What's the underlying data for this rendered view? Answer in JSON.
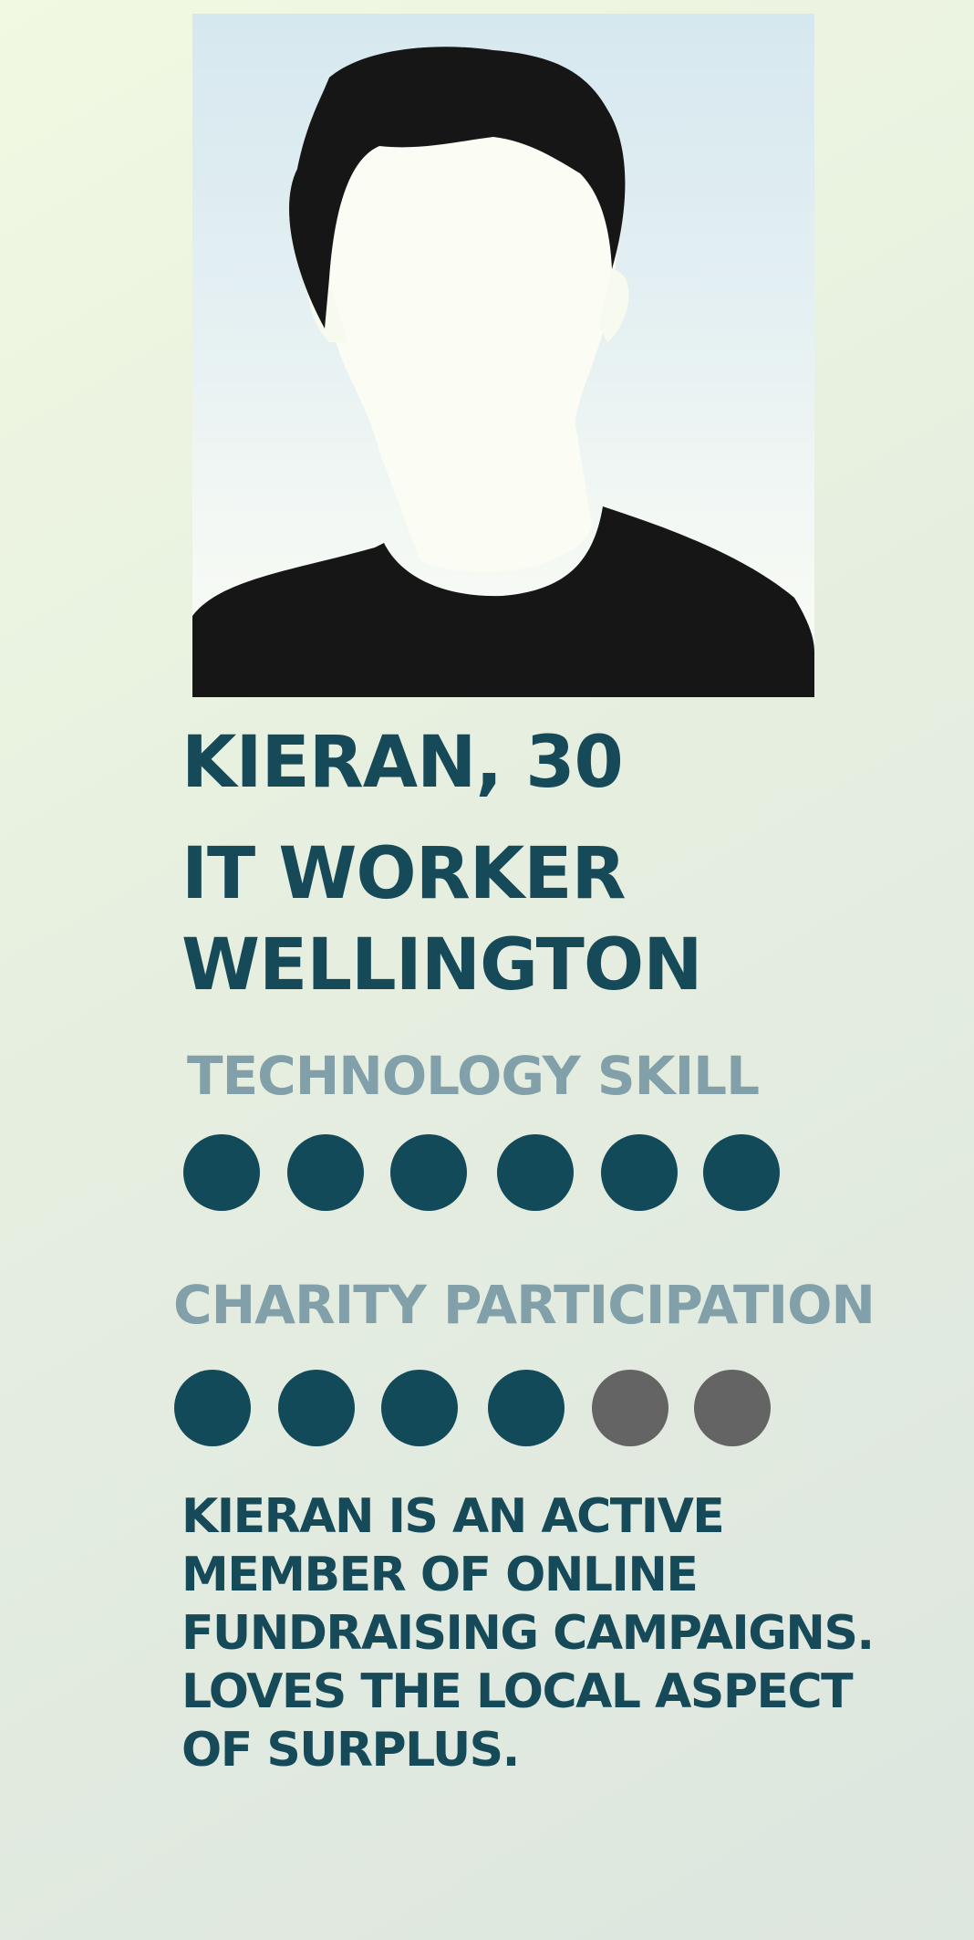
{
  "profile": {
    "name_age": "KIERAN, 30",
    "occupation": "IT WORKER",
    "city": "WELLINGTON",
    "avatar_icon": "person-silhouette-icon",
    "description": "KIERAN IS AN ACTIVE MEMBER OF ONLINE FUNDRAISING CAMPAIGNS.  LOVES THE LOCAL ASPECT OF SURPLUS."
  },
  "ratings": {
    "technology_skill": {
      "label": "TECHNOLOGY SKILL",
      "value": 6,
      "max": 6
    },
    "charity_participation": {
      "label": "CHARITY PARTICIPATION",
      "value": 4,
      "max": 6
    }
  },
  "colors": {
    "primary": "#134a5a",
    "muted_heading": "#81a0a9",
    "inactive_dot": "#646464"
  }
}
